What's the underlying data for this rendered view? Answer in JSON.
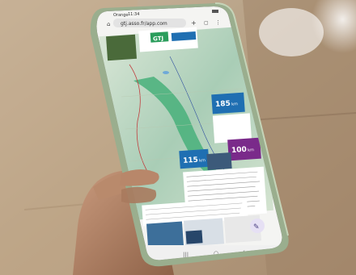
{
  "status_bar": {
    "carrier": "Orange",
    "time": "11:34"
  },
  "browser": {
    "url": "gtj.asso.fr/app.com"
  },
  "brand": {
    "logo_text": "GTJ"
  },
  "map_labels": {
    "stat_1_number": "185",
    "stat_1_unit": "km",
    "stat_2_number": "115",
    "stat_2_unit": "km",
    "stat_3_number": "100",
    "stat_3_unit": "km"
  }
}
